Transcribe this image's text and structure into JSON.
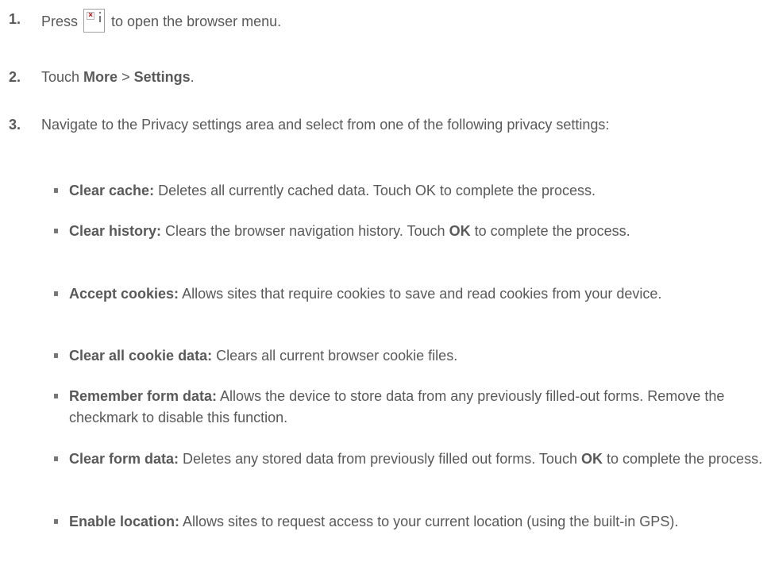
{
  "steps": [
    {
      "number": "1.",
      "pre": "Press ",
      "post": " to open the browser menu.",
      "icon": "browser-menu-icon"
    },
    {
      "number": "2.",
      "pre": "Touch ",
      "bold1": "More",
      "mid": " > ",
      "bold2": "Settings",
      "post": "."
    },
    {
      "number": "3.",
      "text": "Navigate to the Privacy settings area and select from one of the following privacy settings:"
    }
  ],
  "settings": [
    {
      "term": "Clear cache:",
      "desc": " Deletes all currently cached data. Touch OK to complete the process."
    },
    {
      "term": "Clear history:",
      "desc": " Clears the browser navigation history. Touch ",
      "ok": "OK",
      "tail": " to complete the process."
    },
    {
      "term": "Accept cookies:",
      "desc": " Allows sites that require cookies to save and read cookies from your device."
    },
    {
      "term": "Clear all cookie data:",
      "desc": " Clears all current browser cookie files."
    },
    {
      "term": "Remember form data:",
      "desc": " Allows the device to store data from any previously filled-out forms. Remove the checkmark to disable this function."
    },
    {
      "term": "Clear form data:",
      "desc": " Deletes any stored data from previously filled out forms. Touch ",
      "ok": "OK",
      "tail": " to complete the process."
    },
    {
      "term": "Enable location:",
      "desc": " Allows sites to request access to your current location (using the built-in GPS)."
    }
  ]
}
